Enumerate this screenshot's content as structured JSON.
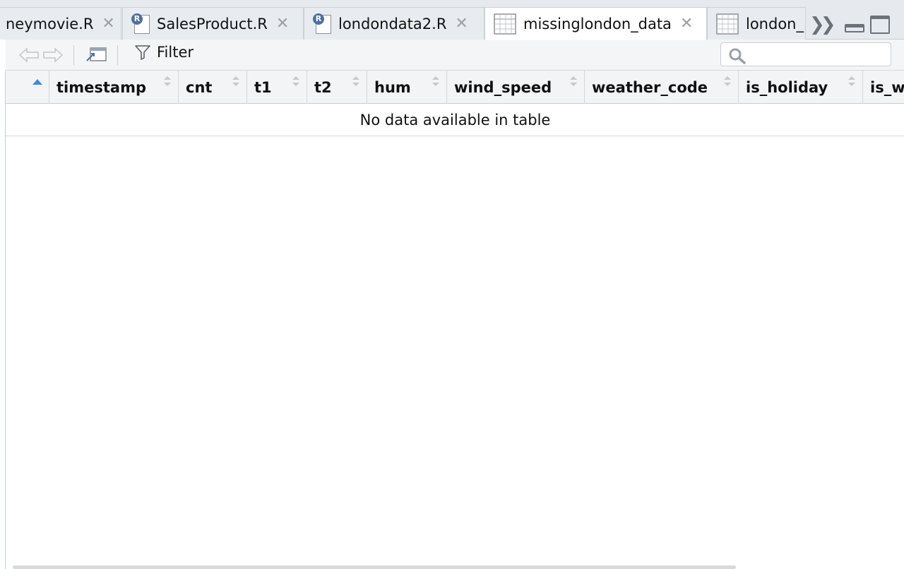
{
  "tabs": [
    {
      "label": "neymovie.R",
      "type": "r"
    },
    {
      "label": "SalesProduct.R",
      "type": "r"
    },
    {
      "label": "londondata2.R",
      "type": "r"
    },
    {
      "label": "missinglondon_data",
      "type": "data",
      "active": true
    },
    {
      "label": "london_",
      "type": "data"
    }
  ],
  "toolbar": {
    "filter_label": "Filter",
    "search_value": ""
  },
  "table": {
    "columns": [
      "timestamp",
      "cnt",
      "t1",
      "t2",
      "hum",
      "wind_speed",
      "weather_code",
      "is_holiday",
      "is_w"
    ],
    "empty_message": "No data available in table"
  },
  "colors": {
    "tabbar_bg": "#e6eaee",
    "header_bg": "#f2f4f6",
    "accent_sort": "#3b8be0",
    "r_badge": "#4f6fa0"
  },
  "icons": {
    "tab_close": "close-icon",
    "r_file": "r-file-icon",
    "data_grid": "data-grid-icon",
    "overflow": "chevron-double-right-icon",
    "back": "arrow-left-icon",
    "forward": "arrow-right-icon",
    "popout": "popout-icon",
    "filter": "filter-icon",
    "search": "search-icon"
  }
}
